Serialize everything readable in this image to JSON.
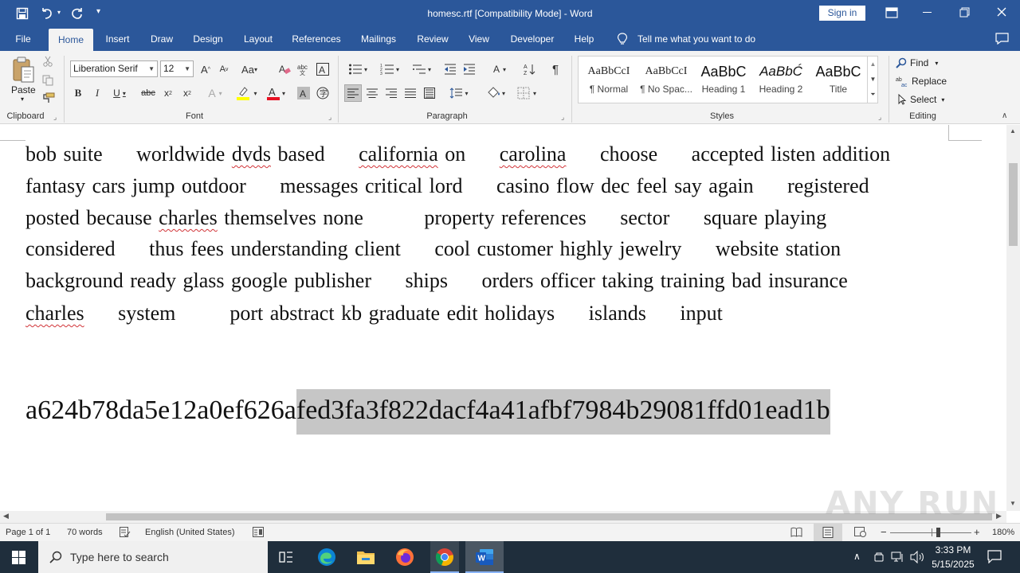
{
  "window": {
    "title": "homesc.rtf [Compatibility Mode]  -  Word",
    "sign_in": "Sign in"
  },
  "tabs": [
    "File",
    "Home",
    "Insert",
    "Draw",
    "Design",
    "Layout",
    "References",
    "Mailings",
    "Review",
    "View",
    "Developer",
    "Help"
  ],
  "tell_me": "Tell me what you want to do",
  "ribbon": {
    "clipboard": {
      "paste": "Paste",
      "label": "Clipboard"
    },
    "font": {
      "name": "Liberation Serif",
      "size": "12",
      "label": "Font"
    },
    "paragraph": {
      "label": "Paragraph"
    },
    "styles": {
      "label": "Styles",
      "items": [
        {
          "preview": "AaBbCcI",
          "name": "¶ Normal"
        },
        {
          "preview": "AaBbCcI",
          "name": "¶ No Spac..."
        },
        {
          "preview": "AaBbC",
          "name": "Heading 1"
        },
        {
          "preview": "AaBbĆ",
          "name": "Heading 2"
        },
        {
          "preview": "AaBbC",
          "name": "Title"
        }
      ]
    },
    "editing": {
      "find": "Find",
      "replace": "Replace",
      "select": "Select",
      "label": "Editing"
    }
  },
  "document": {
    "lines": [
      [
        {
          "t": "bob suite     worldwide "
        },
        {
          "t": "dvds",
          "sq": true
        },
        {
          "t": " based     "
        },
        {
          "t": "california",
          "sq": true
        },
        {
          "t": " on     "
        },
        {
          "t": "carolina",
          "sq": true
        },
        {
          "t": "     choose     accepted listen addition"
        }
      ],
      [
        {
          "t": "fantasy cars jump outdoor     messages critical lord     casino flow dec feel say again     registered"
        }
      ],
      [
        {
          "t": "posted because "
        },
        {
          "t": "charles",
          "sq": true
        },
        {
          "t": " themselves none         property references     sector     square playing"
        }
      ],
      [
        {
          "t": "considered     thus fees understanding client     cool customer highly jewelry     website station"
        }
      ],
      [
        {
          "t": "background ready glass google publisher     ships     orders officer taking training bad insurance"
        }
      ],
      [
        {
          "t": "charles",
          "sq": true
        },
        {
          "t": "     system        port abstract kb graduate edit holidays     islands     input"
        }
      ]
    ],
    "hash_plain": "a624b78da5e12a0ef626a",
    "hash_selected": "fed3fa3f822dacf4a41afbf7984b29081ffd01ead1b"
  },
  "status": {
    "page": "Page 1 of 1",
    "words": "70 words",
    "language": "English (United States)",
    "zoom": "180%"
  },
  "taskbar": {
    "search_placeholder": "Type here to search",
    "time": "3:33 PM",
    "date": "5/15/2025"
  },
  "watermark": "ANY RUN",
  "colors": {
    "accent": "#2b579a",
    "spell": "#d13438",
    "selection": "#c6c6c6"
  }
}
